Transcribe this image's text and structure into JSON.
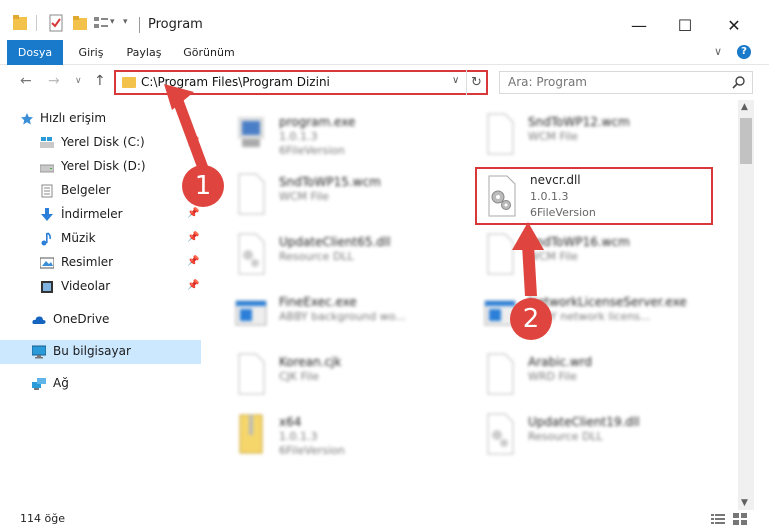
{
  "window": {
    "title": "Program",
    "minimize_glyph": "—",
    "maximize_glyph": "☐",
    "close_glyph": "✕"
  },
  "ribbon": {
    "tabs": [
      "Dosya",
      "Giriş",
      "Paylaş",
      "Görünüm"
    ],
    "chevron": "∨",
    "help": "?"
  },
  "address": {
    "path": "C:\\Program Files\\Program Dizini",
    "dropdown": "∨",
    "refresh": "↻"
  },
  "search": {
    "placeholder": "Ara: Program"
  },
  "nav": {
    "back": "←",
    "forward": "→",
    "recent": "∨",
    "up": "↑"
  },
  "sidebar": {
    "items": [
      {
        "label": "Hızlı erişim",
        "icon": "star-icon"
      },
      {
        "label": "Yerel Disk (C:)",
        "icon": "windows-drive-icon"
      },
      {
        "label": "Yerel Disk (D:)",
        "icon": "drive-icon"
      },
      {
        "label": "Belgeler",
        "icon": "documents-icon"
      },
      {
        "label": "İndirmeler",
        "icon": "download-icon"
      },
      {
        "label": "Müzik",
        "icon": "music-icon"
      },
      {
        "label": "Resimler",
        "icon": "pictures-icon"
      },
      {
        "label": "Videolar",
        "icon": "videos-icon"
      },
      {
        "label": "OneDrive",
        "icon": "onedrive-icon"
      },
      {
        "label": "Bu bilgisayar",
        "icon": "computer-icon"
      },
      {
        "label": "Ağ",
        "icon": "network-icon"
      }
    ]
  },
  "files": [
    {
      "name": "program.exe",
      "line2": "1.0.1.3",
      "line3": "6FileVersion"
    },
    {
      "name": "SndToWP12.wcm",
      "line2": "WCM File",
      "line3": ""
    },
    {
      "name": "SndToWP15.wcm",
      "line2": "WCM File",
      "line3": ""
    },
    {
      "name": "nevcr.dll",
      "line2": "1.0.1.3",
      "line3": "6FileVersion"
    },
    {
      "name": "UpdateClient65.dll",
      "line2": "Resource DLL",
      "line3": ""
    },
    {
      "name": "SndToWP16.wcm",
      "line2": "WCM File",
      "line3": ""
    },
    {
      "name": "FineExec.exe",
      "line2": "ABBY background wo...",
      "line3": ""
    },
    {
      "name": "NetworkLicenseServer.exe",
      "line2": "ABBY network licens...",
      "line3": ""
    },
    {
      "name": "Korean.cjk",
      "line2": "CJK File",
      "line3": ""
    },
    {
      "name": "Arabic.wrd",
      "line2": "WRD File",
      "line3": ""
    },
    {
      "name": "x64",
      "line2": "1.0.1.3",
      "line3": "6FileVersion"
    },
    {
      "name": "UpdateClient19.dll",
      "line2": "Resource DLL",
      "line3": ""
    }
  ],
  "status": {
    "count": "114 öğe"
  },
  "annotations": {
    "step1": "1",
    "step2": "2",
    "color": "#e0443e"
  },
  "colors": {
    "accent": "#1979ca",
    "highlight": "#d9383a",
    "selected": "#cce8ff"
  }
}
